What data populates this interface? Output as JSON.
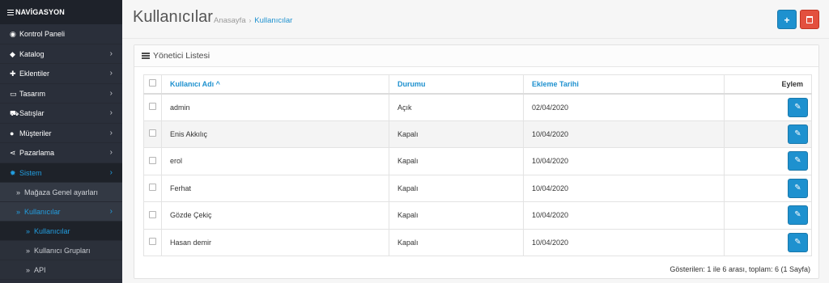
{
  "nav": {
    "heading": "NAVİGASYON",
    "items": [
      {
        "label": "Kontrol Paneli",
        "icon": "dashboard-icon",
        "glyph": "◉",
        "chevron": ""
      },
      {
        "label": "Katalog",
        "icon": "tag-icon",
        "glyph": "◆",
        "chevron": "›"
      },
      {
        "label": "Eklentiler",
        "icon": "puzzle-icon",
        "glyph": "✚",
        "chevron": "›"
      },
      {
        "label": "Tasarım",
        "icon": "desktop-icon",
        "glyph": "▭",
        "chevron": "›"
      },
      {
        "label": "Satışlar",
        "icon": "cart-icon",
        "glyph": "⛟",
        "chevron": "›"
      },
      {
        "label": "Müşteriler",
        "icon": "user-icon",
        "glyph": "●",
        "chevron": "›"
      },
      {
        "label": "Pazarlama",
        "icon": "share-icon",
        "glyph": "⋖",
        "chevron": "›"
      },
      {
        "label": "Sistem",
        "icon": "gear-icon",
        "glyph": "✹",
        "chevron": "›"
      }
    ],
    "sub": [
      {
        "label": "Mağaza Genel ayarları"
      },
      {
        "label": "Kullanıcılar",
        "chevron": "›"
      }
    ],
    "subsub": [
      {
        "label": "Kullanıcılar"
      },
      {
        "label": "Kullanıcı Grupları"
      },
      {
        "label": "API"
      }
    ],
    "raquo": "»"
  },
  "header": {
    "title": "Kullanıcılar",
    "breadcrumb": [
      "Anasayfa",
      "Kullanıcılar"
    ],
    "breadcrumb_sep": "›",
    "add_glyph": "+",
    "delete_glyph": "🗑"
  },
  "panel": {
    "title": "Yönetici Listesi"
  },
  "table": {
    "columns": {
      "user": "Kullanıcı Adı ^",
      "status": "Durumu",
      "date": "Ekleme Tarihi",
      "action": "Eylem"
    },
    "rows": [
      {
        "user": "admin",
        "status": "Açık",
        "date": "02/04/2020"
      },
      {
        "user": "Enis Akkılıç",
        "status": "Kapalı",
        "date": "10/04/2020"
      },
      {
        "user": "erol",
        "status": "Kapalı",
        "date": "10/04/2020"
      },
      {
        "user": "Ferhat",
        "status": "Kapalı",
        "date": "10/04/2020"
      },
      {
        "user": "Gözde Çekiç",
        "status": "Kapalı",
        "date": "10/04/2020"
      },
      {
        "user": "Hasan demir",
        "status": "Kapalı",
        "date": "10/04/2020"
      }
    ],
    "edit_glyph": "✎"
  },
  "pager": "Gösterilen: 1 ile 6 arası, toplam: 6 (1 Sayfa)",
  "colors": {
    "accent": "#1e91cf",
    "danger": "#e3503e",
    "sidebar": "#2a2f3a"
  }
}
